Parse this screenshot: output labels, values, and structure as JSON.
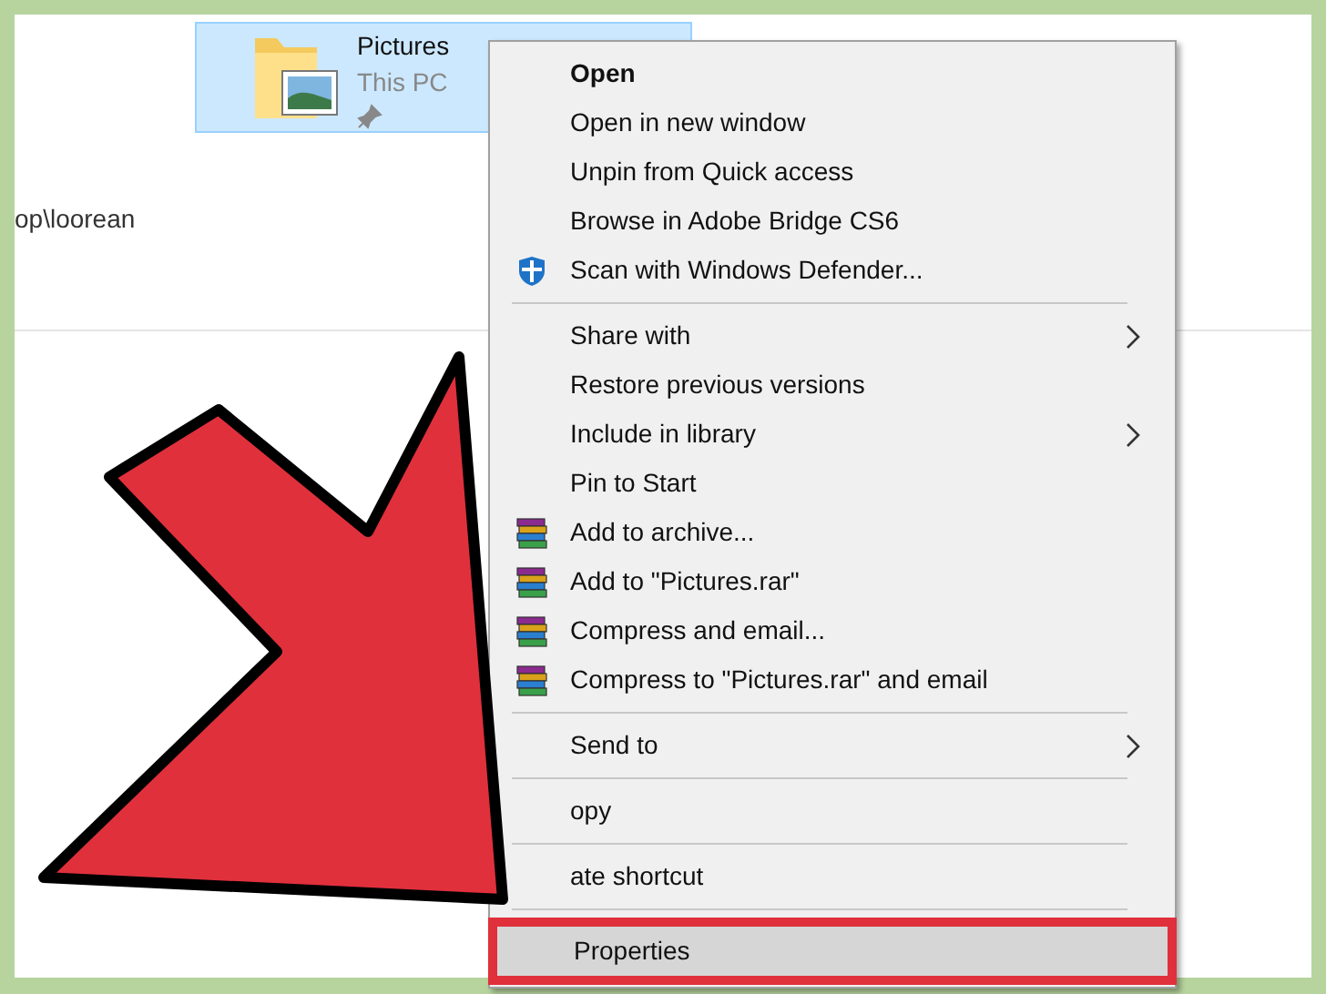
{
  "address": "op\\loorean",
  "folder": {
    "name": "Pictures",
    "location": "This PC",
    "pinned": true,
    "selected": true
  },
  "context_menu": {
    "sections": [
      [
        {
          "label": "Open",
          "default": true,
          "kind": "plain",
          "submenu": false,
          "selected": false
        },
        {
          "label": "Open in new window",
          "default": false,
          "kind": "plain",
          "submenu": false,
          "selected": false
        },
        {
          "label": "Unpin from Quick access",
          "default": false,
          "kind": "plain",
          "submenu": false,
          "selected": false
        },
        {
          "label": "Browse in Adobe Bridge CS6",
          "default": false,
          "kind": "plain",
          "submenu": false,
          "selected": false
        },
        {
          "label": "Scan with Windows Defender...",
          "default": false,
          "kind": "shield",
          "submenu": false,
          "selected": false
        }
      ],
      [
        {
          "label": "Share with",
          "default": false,
          "kind": "plain",
          "submenu": true,
          "selected": false
        },
        {
          "label": "Restore previous versions",
          "default": false,
          "kind": "plain",
          "submenu": false,
          "selected": false
        },
        {
          "label": "Include in library",
          "default": false,
          "kind": "plain",
          "submenu": true,
          "selected": false
        },
        {
          "label": "Pin to Start",
          "default": false,
          "kind": "plain",
          "submenu": false,
          "selected": false
        },
        {
          "label": "Add to archive...",
          "default": false,
          "kind": "archive",
          "submenu": false,
          "selected": false
        },
        {
          "label": "Add to \"Pictures.rar\"",
          "default": false,
          "kind": "archive",
          "submenu": false,
          "selected": false
        },
        {
          "label": "Compress and email...",
          "default": false,
          "kind": "archive",
          "submenu": false,
          "selected": false
        },
        {
          "label": "Compress to \"Pictures.rar\" and email",
          "default": false,
          "kind": "archive",
          "submenu": false,
          "selected": false
        }
      ],
      [
        {
          "label": "Send to",
          "default": false,
          "kind": "plain",
          "submenu": true,
          "selected": false
        }
      ],
      [
        {
          "label": "opy",
          "default": false,
          "kind": "plain",
          "submenu": false,
          "selected": false
        }
      ],
      [
        {
          "label": "ate shortcut",
          "default": false,
          "kind": "plain",
          "submenu": false,
          "selected": false
        }
      ],
      [
        {
          "label": "Properties",
          "default": false,
          "kind": "plain",
          "submenu": false,
          "selected": true
        }
      ]
    ]
  }
}
